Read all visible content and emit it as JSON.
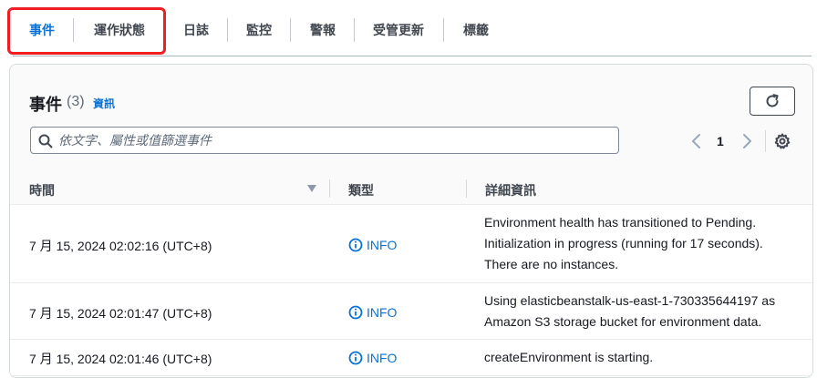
{
  "tabs": [
    {
      "label": "事件",
      "active": true
    },
    {
      "label": "運作狀態",
      "active": false
    },
    {
      "label": "日誌",
      "active": false
    },
    {
      "label": "監控",
      "active": false
    },
    {
      "label": "警報",
      "active": false
    },
    {
      "label": "受管更新",
      "active": false
    },
    {
      "label": "標籤",
      "active": false
    }
  ],
  "panel": {
    "title": "事件",
    "count": "(3)",
    "info_link": "資訊",
    "search_placeholder": "依文字、屬性或值篩選事件",
    "page_number": "1"
  },
  "table": {
    "columns": [
      "時間",
      "類型",
      "詳細資訊"
    ],
    "rows": [
      {
        "time": "7 月 15, 2024 02:02:16 (UTC+8)",
        "type": "INFO",
        "details": [
          "Environment health has transitioned to Pending.",
          "Initialization in progress (running for 17 seconds).",
          "There are no instances."
        ]
      },
      {
        "time": "7 月 15, 2024 02:01:47 (UTC+8)",
        "type": "INFO",
        "details": [
          "Using elasticbeanstalk-us-east-1-730335644197 as",
          "Amazon S3 storage bucket for environment data."
        ]
      },
      {
        "time": "7 月 15, 2024 02:01:46 (UTC+8)",
        "type": "INFO",
        "details": [
          "createEnvironment is starting."
        ]
      }
    ]
  },
  "colors": {
    "accent": "#0972d3",
    "highlight": "#ef1d24",
    "text": "#16191f"
  },
  "icons": {
    "refresh": "refresh-icon",
    "search": "search-icon",
    "settings": "gear-icon",
    "info": "info-circle-icon",
    "sort": "sort-down-icon"
  }
}
